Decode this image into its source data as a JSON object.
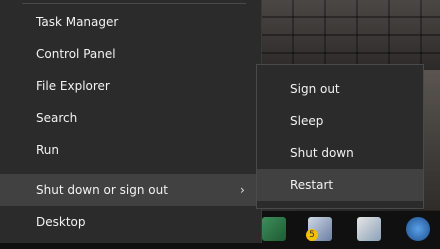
{
  "main_menu": {
    "items": [
      {
        "label": "Task Manager"
      },
      {
        "label": "Control Panel"
      },
      {
        "label": "File Explorer"
      },
      {
        "label": "Search"
      },
      {
        "label": "Run"
      },
      {
        "label": "Shut down or sign out",
        "has_submenu": true,
        "highlighted": true
      },
      {
        "label": "Desktop"
      }
    ],
    "submenu_arrow": "›"
  },
  "submenu": {
    "items": [
      {
        "label": "Sign out"
      },
      {
        "label": "Sleep"
      },
      {
        "label": "Shut down"
      },
      {
        "label": "Restart",
        "highlighted": true
      }
    ]
  },
  "taskbar": {
    "icons": [
      "app-icon",
      "computer-icon",
      "display-icon",
      "thunderbird-icon"
    ],
    "badge": "5"
  },
  "colors": {
    "menu_bg": "#2b2b2b",
    "highlight": "#414141",
    "text": "#f2f2f2"
  }
}
